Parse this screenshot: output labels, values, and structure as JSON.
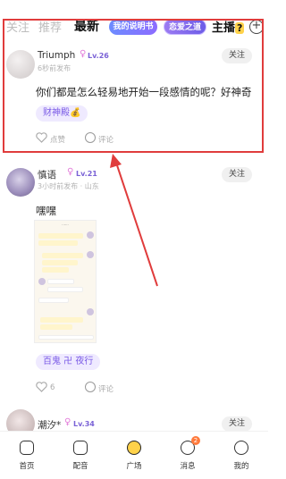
{
  "tabs": {
    "follow": "关注",
    "recommend": "推荐",
    "latest": "最新",
    "pill1": "我的说明书",
    "pill2": "恋爱之道",
    "live": "主播",
    "live_mark": "?"
  },
  "posts": [
    {
      "user": "Triumph",
      "gender": "♀",
      "level": "Lv.26",
      "time": "6秒前发布",
      "follow": "关注",
      "content": "你们都是怎么轻易地开始一段感情的呢？好神奇",
      "topic": "财神殿💰",
      "likes": "点赞",
      "comments": "评论"
    },
    {
      "user": "慎语",
      "gender": "♀",
      "level": "Lv.21",
      "time": "3小时前发布 · 山东",
      "follow": "关注",
      "content": "嘿嘿",
      "topic": "百鬼 卍 夜行",
      "likes": "6",
      "comments": "评论"
    },
    {
      "user": "潮汐*",
      "gender": "♀",
      "level": "Lv.34",
      "follow": "关注"
    }
  ],
  "nav": [
    {
      "label": "首页",
      "icon": "home-icon"
    },
    {
      "label": "配音",
      "icon": "dubbing-icon"
    },
    {
      "label": "广场",
      "icon": "planet-icon"
    },
    {
      "label": "消息",
      "icon": "message-icon",
      "badge": "2"
    },
    {
      "label": "我的",
      "icon": "profile-icon"
    }
  ],
  "colors": {
    "highlight": "#e03c3c",
    "accent": "#7a5ae6",
    "badge": "#ff7a3c"
  }
}
